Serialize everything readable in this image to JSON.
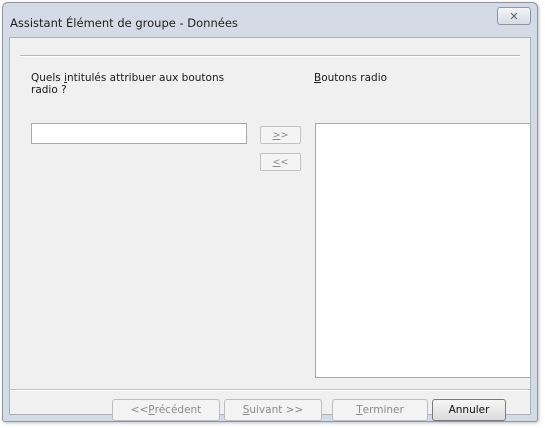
{
  "window": {
    "title": "Assistant Élément de groupe - Données",
    "close_glyph": "✕"
  },
  "labels": {
    "left_pre": "Quels ",
    "left_accel": "i",
    "left_post": "ntitulés attribuer aux boutons radio ?",
    "right_accel": "B",
    "right_post": "outons radio"
  },
  "input": {
    "value": ""
  },
  "move_buttons": {
    "add_accel": ">",
    "add_post": ">",
    "remove_accel": "<",
    "remove_post": "<"
  },
  "list": {
    "items": []
  },
  "footer": {
    "prev_pre": "<< ",
    "prev_accel": "P",
    "prev_post": "récédent",
    "next_accel": "S",
    "next_post": "uivant >>",
    "finish_accel": "T",
    "finish_post": "erminer",
    "cancel": "Annuler"
  }
}
